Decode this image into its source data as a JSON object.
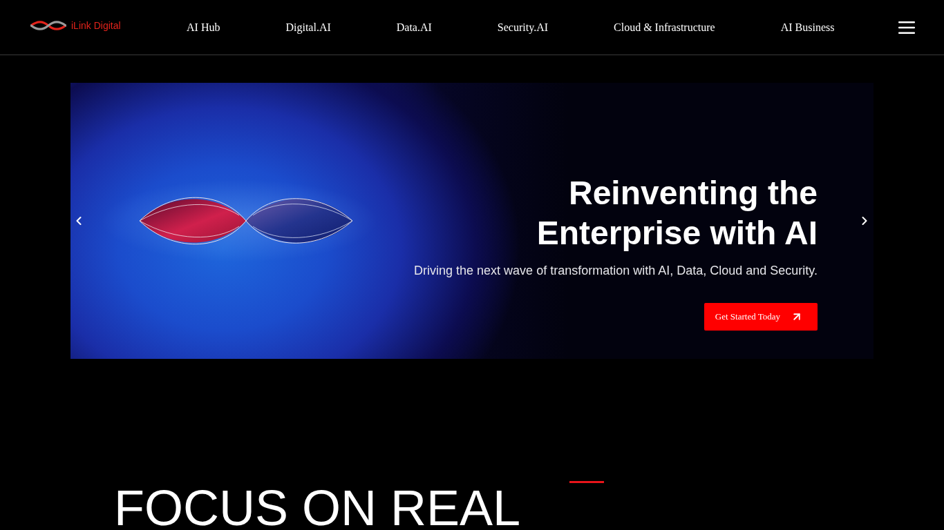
{
  "header": {
    "logo": {
      "text": "iLink Digital"
    },
    "nav": [
      {
        "label": "AI Hub"
      },
      {
        "label": "Digital.AI"
      },
      {
        "label": "Data.AI"
      },
      {
        "label": "Security.AI"
      },
      {
        "label": "Cloud & Infrastructure"
      },
      {
        "label": "AI Business"
      }
    ]
  },
  "hero": {
    "title": "Reinventing the Enterprise with AI",
    "subtitle": "Driving the next wave of transformation with AI, Data, Cloud and Security.",
    "button": "Get Started Today"
  },
  "section": {
    "heading": "FOCUS ON REAL"
  }
}
